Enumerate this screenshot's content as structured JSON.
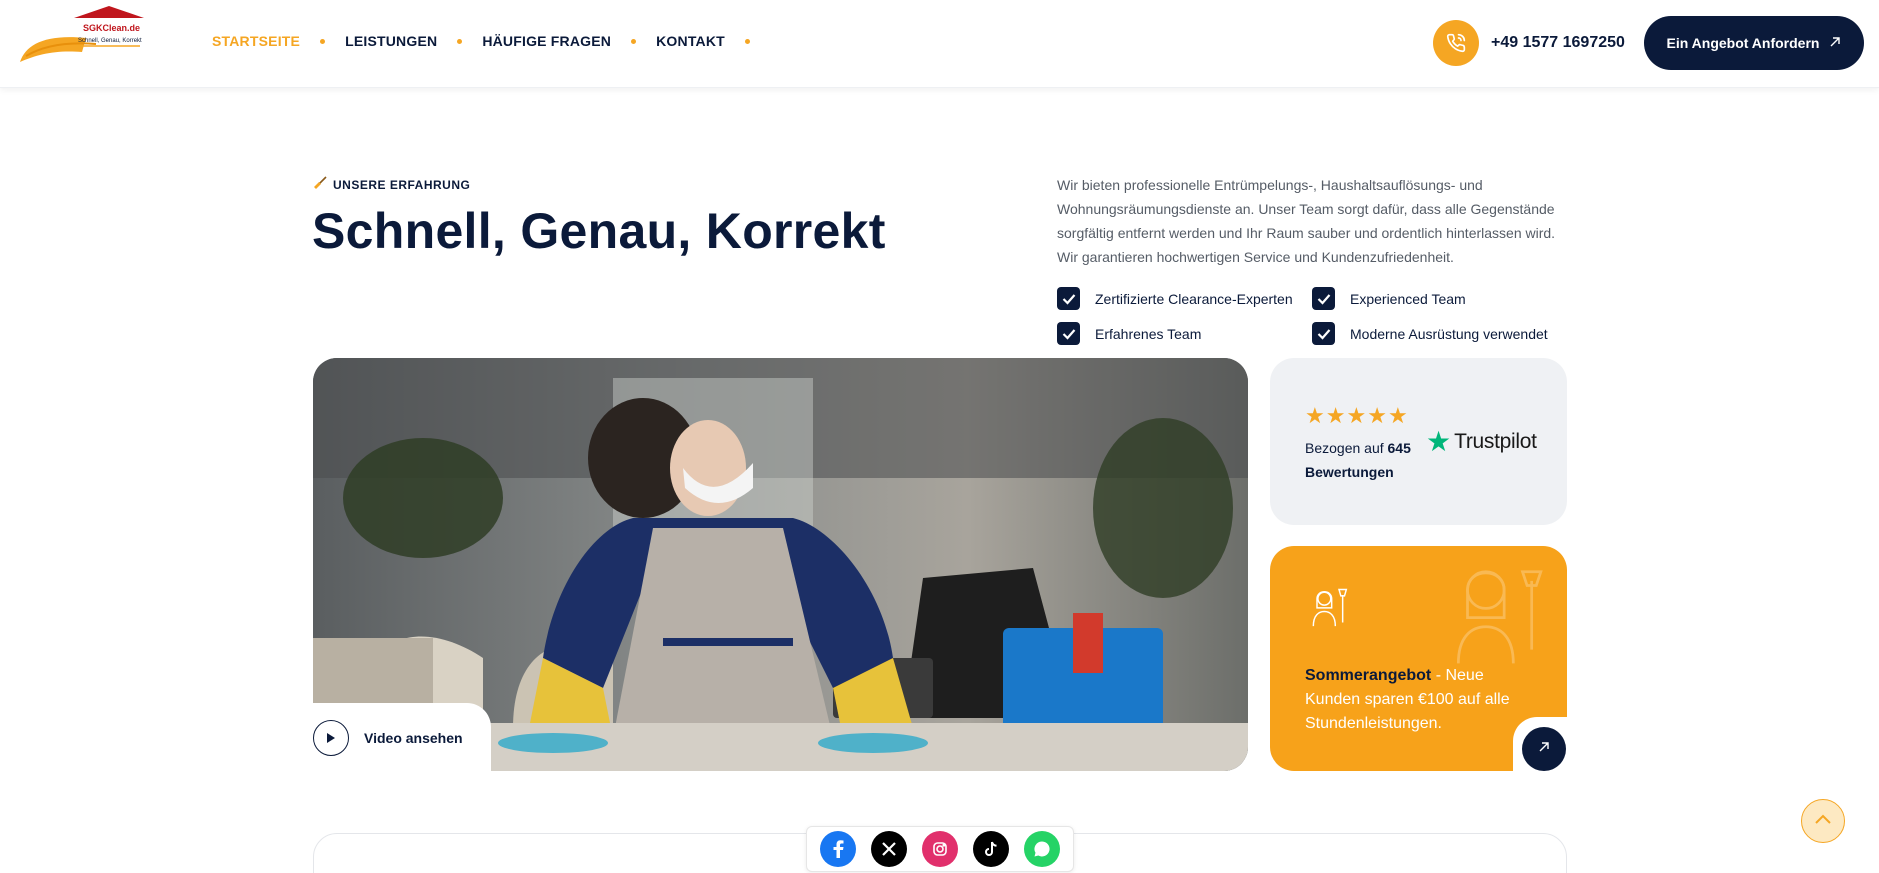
{
  "colors": {
    "accent": "#f5a623",
    "navy": "#0b1a3a",
    "card_grey": "#eff1f4",
    "offer_orange": "#f7a21a",
    "trustpilot_green": "#00b67a"
  },
  "header": {
    "logo": {
      "brand": "SGKClean.de",
      "tagline": "Schnell, Genau, Korrekt"
    },
    "nav": [
      {
        "label": "STARTSEITE",
        "active": true
      },
      {
        "label": "LEISTUNGEN",
        "active": false
      },
      {
        "label": "HÄUFIGE FRAGEN",
        "active": false
      },
      {
        "label": "KONTAKT",
        "active": false
      }
    ],
    "phone": {
      "icon": "phone-icon",
      "number": "+49 1577 1697250"
    },
    "cta": {
      "label": "Ein Angebot Anfordern",
      "icon": "arrow-up-right-icon"
    }
  },
  "hero": {
    "eyebrow": {
      "icon": "broom-icon",
      "label": "UNSERE ERFAHRUNG"
    },
    "title": "Schnell, Genau, Korrekt",
    "description": "Wir bieten professionelle Entrümpelungs-, Haushaltsauflösungs- und Wohnungsräumungsdienste an. Unser Team sorgt dafür, dass alle Gegenstände sorgfältig entfernt werden und Ihr Raum sauber und ordentlich hinterlassen wird. Wir garantieren hochwertigen Service und Kundenzufriedenheit.",
    "checklist": [
      "Zertifizierte Clearance-Experten",
      "Experienced Team",
      "Erfahrenes Team",
      "Moderne Ausrüstung verwendet"
    ]
  },
  "photo": {
    "video_label": "Video ansehen",
    "play_icon": "play-icon"
  },
  "trust_card": {
    "rating": 5,
    "prefix": "Bezogen auf",
    "count": "645",
    "suffix": "Bewertungen",
    "brand": "Trustpilot"
  },
  "offer_card": {
    "icon": "cleaning-woman-icon",
    "highlight": "Sommerangebot",
    "text": " - Neue Kunden sparen €100 auf alle Stundenleistungen.",
    "arrow_icon": "arrow-up-right-icon"
  },
  "social": [
    {
      "name": "facebook",
      "icon": "facebook-icon",
      "glyph": "f",
      "color": "#1877f2"
    },
    {
      "name": "x",
      "icon": "x-icon",
      "glyph": "X",
      "color": "#000000"
    },
    {
      "name": "instagram",
      "icon": "instagram-icon",
      "glyph": "",
      "color": "#e1306c"
    },
    {
      "name": "tiktok",
      "icon": "tiktok-icon",
      "glyph": "♪",
      "color": "#000000"
    },
    {
      "name": "whatsapp",
      "icon": "whatsapp-icon",
      "glyph": "",
      "color": "#25d366"
    }
  ],
  "back_to_top": {
    "icon": "chevron-up-icon"
  }
}
